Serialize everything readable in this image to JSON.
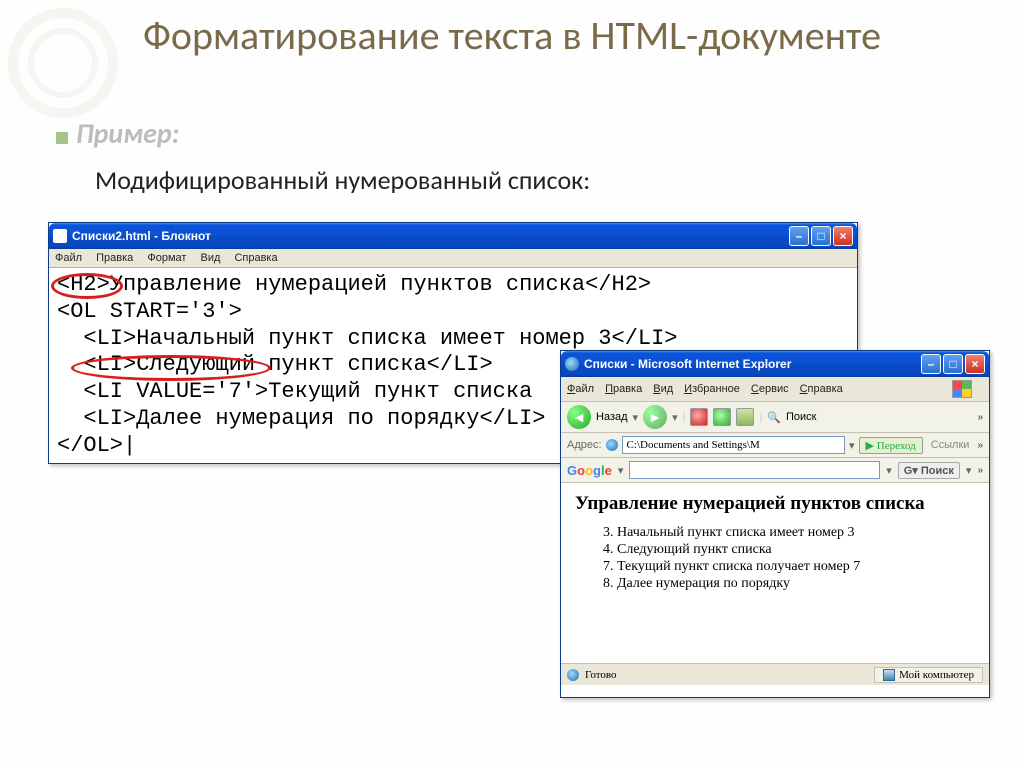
{
  "slide": {
    "title": "Форматирование текста в HTML-документе",
    "example_label": "Пример:",
    "subtitle": "Модифицированный нумерованный список:"
  },
  "notepad": {
    "title": "Списки2.html - Блокнот",
    "menu": {
      "file": "Файл",
      "edit": "Правка",
      "format": "Формат",
      "view": "Вид",
      "help": "Справка"
    },
    "code": "<H2>Управление нумерацией пунктов списка</H2>\n<OL START='3'>\n  <LI>Начальный пункт списка имеет номер 3</LI>\n  <LI>Следующий пункт списка</LI>\n  <LI VALUE='7'>Текущий пункт списка\n  <LI>Далее нумерация по порядку</LI>\n</OL>|"
  },
  "ie": {
    "title": "Списки - Microsoft Internet Explorer",
    "menu": {
      "file": "Файл",
      "edit": "Правка",
      "view": "Вид",
      "fav": "Избранное",
      "tools": "Сервис",
      "help": "Справка"
    },
    "nav": {
      "back": "Назад",
      "search": "Поиск"
    },
    "addr": {
      "label": "Адрес:",
      "value": "C:\\Documents and Settings\\М",
      "go": "Переход",
      "links": "Ссылки"
    },
    "google": {
      "search_btn": "Поиск"
    },
    "page": {
      "heading": "Управление нумерацией пунктов списка",
      "items": {
        "i3": "Начальный пункт списка имеет номер 3",
        "i4": "Следующий пункт списка",
        "i7": "Текущий пункт списка получает номер 7",
        "i8": "Далее нумерация по порядку"
      }
    },
    "status": {
      "ready": "Готово",
      "zone": "Мой компьютер"
    }
  }
}
